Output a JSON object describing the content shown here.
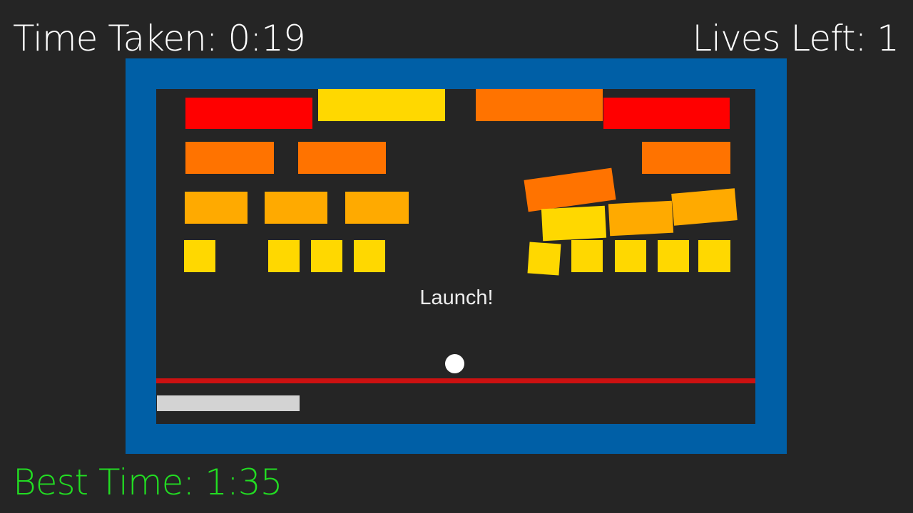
{
  "hud": {
    "time_taken": "Time Taken: 0:19",
    "lives_left": "Lives Left: 1",
    "best_time": "Best Time: 1:35"
  },
  "status": {
    "launch_prompt": "Launch!"
  },
  "colors": {
    "background": "#252525",
    "frame": "#005fa6",
    "play_area": "#252525",
    "hud_text": "#ffffff",
    "best_time_text": "#22dd22",
    "launch_text": "#eeeeee",
    "ball": "#ffffff",
    "danger_line": "#cc1111",
    "paddle": "#d3d3d3",
    "brick_red": "#ff0000",
    "brick_dark_orange": "#ff7300",
    "brick_orange": "#ffaa00",
    "brick_yellow": "#ffd800"
  },
  "bricks": [
    {
      "color": "brick_red"
    },
    {
      "color": "brick_yellow"
    },
    {
      "color": "brick_dark_orange"
    },
    {
      "color": "brick_red"
    },
    {
      "color": "brick_dark_orange"
    },
    {
      "color": "brick_dark_orange"
    },
    {
      "color": "brick_dark_orange"
    },
    {
      "color": "brick_orange"
    },
    {
      "color": "brick_orange"
    },
    {
      "color": "brick_orange"
    },
    {
      "color": "brick_dark_orange"
    },
    {
      "color": "brick_yellow"
    },
    {
      "color": "brick_orange"
    },
    {
      "color": "brick_orange"
    },
    {
      "color": "brick_yellow"
    },
    {
      "color": "brick_yellow"
    },
    {
      "color": "brick_yellow"
    },
    {
      "color": "brick_yellow"
    },
    {
      "color": "brick_yellow"
    },
    {
      "color": "brick_yellow"
    },
    {
      "color": "brick_yellow"
    },
    {
      "color": "brick_yellow"
    },
    {
      "color": "brick_yellow"
    }
  ]
}
